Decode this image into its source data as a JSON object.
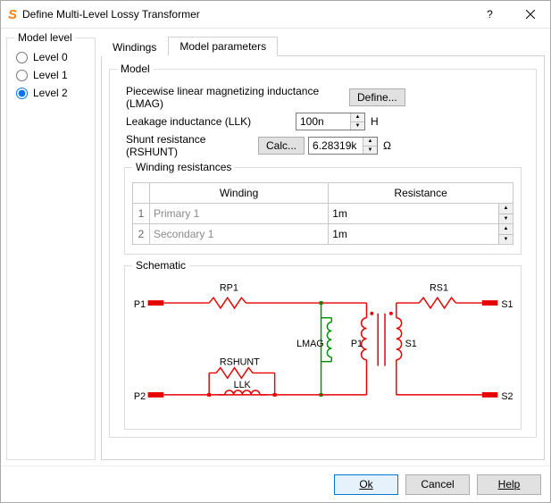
{
  "window": {
    "title": "Define Multi-Level Lossy Transformer"
  },
  "model_level": {
    "legend": "Model level",
    "options": [
      "Level 0",
      "Level 1",
      "Level 2"
    ],
    "selected": 2
  },
  "tabs": {
    "items": [
      {
        "label": "Windings"
      },
      {
        "label": "Model parameters"
      }
    ],
    "active": 1
  },
  "model": {
    "legend": "Model",
    "lmag": {
      "label": "Piecewise linear magnetizing inductance (LMAG)",
      "define_btn": "Define..."
    },
    "llk": {
      "label": "Leakage inductance (LLK)",
      "value": "100n",
      "unit": "H"
    },
    "rshunt": {
      "label": "Shunt resistance (RSHUNT)",
      "calc_btn": "Calc...",
      "value": "6.28319k",
      "unit": "Ω"
    }
  },
  "winding_resistances": {
    "legend": "Winding resistances",
    "headers": {
      "winding": "Winding",
      "resistance": "Resistance"
    },
    "rows": [
      {
        "num": "1",
        "name": "Primary 1",
        "value": "1m"
      },
      {
        "num": "2",
        "name": "Secondary 1",
        "value": "1m"
      }
    ]
  },
  "schematic": {
    "legend": "Schematic",
    "labels": {
      "P1": "P1",
      "P2": "P2",
      "S1": "S1",
      "S2": "S2",
      "RP1": "RP1",
      "RS1": "RS1",
      "LMAG": "LMAG",
      "P1core": "P1",
      "S1core": "S1",
      "RSHUNT": "RSHUNT",
      "LLK": "LLK"
    }
  },
  "footer": {
    "ok": "Ok",
    "cancel": "Cancel",
    "help": "Help"
  }
}
